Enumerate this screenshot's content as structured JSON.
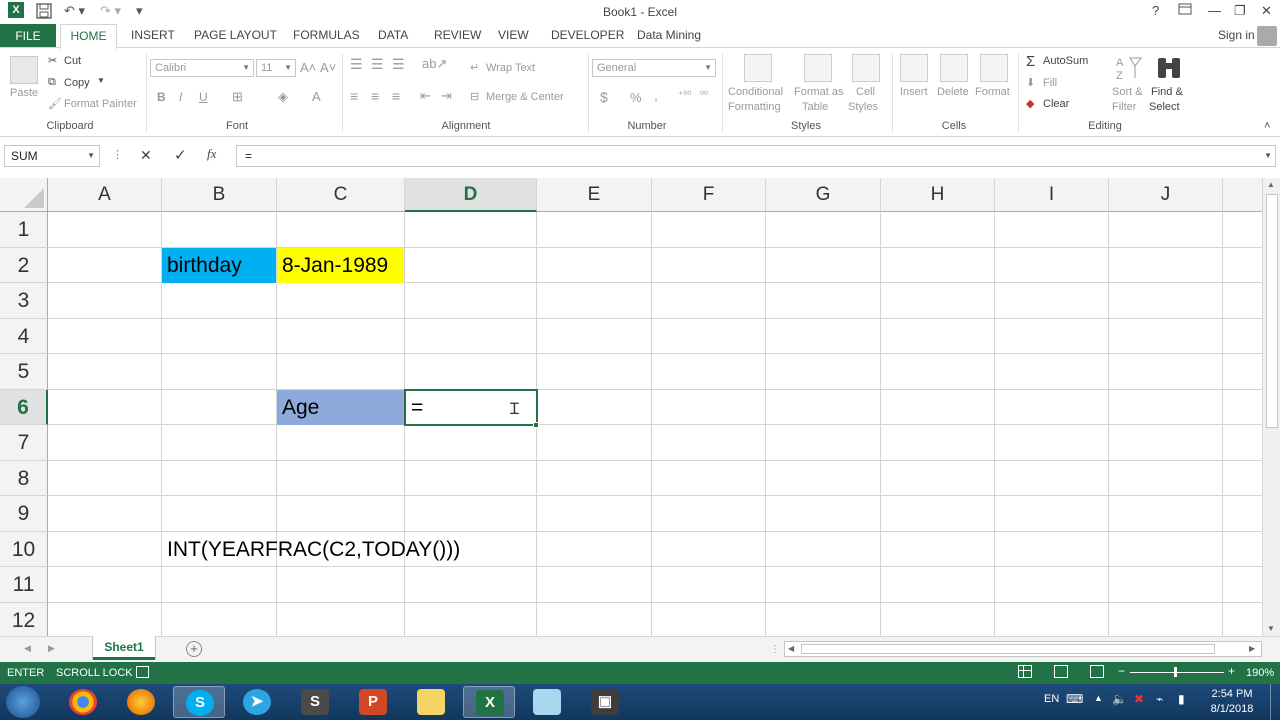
{
  "window": {
    "title": "Book1 - Excel",
    "signin": "Sign in"
  },
  "tabs": {
    "file": "FILE",
    "items": [
      "HOME",
      "INSERT",
      "PAGE LAYOUT",
      "FORMULAS",
      "DATA",
      "REVIEW",
      "VIEW",
      "DEVELOPER",
      "Data Mining"
    ]
  },
  "ribbon": {
    "clipboard": {
      "label": "Clipboard",
      "paste": "Paste",
      "cut": "Cut",
      "copy": "Copy",
      "format_painter": "Format Painter"
    },
    "font": {
      "label": "Font",
      "font_name": "Calibri",
      "font_size": "11",
      "bold": "B",
      "italic": "I",
      "underline": "U"
    },
    "alignment": {
      "label": "Alignment",
      "wrap_text": "Wrap Text",
      "merge_center": "Merge & Center"
    },
    "number": {
      "label": "Number",
      "format": "General",
      "currency": "$",
      "percent": "%",
      "comma": ","
    },
    "styles": {
      "label": "Styles",
      "conditional_1": "Conditional",
      "conditional_2": "Formatting",
      "format_table_1": "Format as",
      "format_table_2": "Table",
      "cell_styles_1": "Cell",
      "cell_styles_2": "Styles"
    },
    "cells": {
      "label": "Cells",
      "insert": "Insert",
      "delete": "Delete",
      "format": "Format"
    },
    "editing": {
      "label": "Editing",
      "autosum": "AutoSum",
      "fill": "Fill",
      "clear": "Clear",
      "sort_1": "Sort &",
      "sort_2": "Filter",
      "find_1": "Find &",
      "find_2": "Select"
    }
  },
  "formula_bar": {
    "name_box": "SUM",
    "cancel": "✕",
    "enter": "✓",
    "fx": "fx",
    "content": "="
  },
  "grid": {
    "columns": [
      "A",
      "B",
      "C",
      "D",
      "E",
      "F",
      "G",
      "H",
      "I",
      "J"
    ],
    "rows": [
      "1",
      "2",
      "3",
      "4",
      "5",
      "6",
      "7",
      "8",
      "9",
      "10",
      "11",
      "12"
    ],
    "selected_column": "D",
    "selected_row": "6",
    "cells": {
      "B2": "birthday",
      "C2": "8-Jan-1989",
      "C6": "Age",
      "D6": "=",
      "B10": "INT(YEARFRAC(C2,TODAY()))"
    },
    "colors": {
      "B2": "#00b0f0",
      "C2": "#ffff00",
      "C6": "#8ea9db",
      "accent": "#217346"
    }
  },
  "sheets": {
    "active": "Sheet1"
  },
  "status": {
    "mode": "ENTER",
    "scroll_lock": "SCROLL LOCK",
    "zoom": "190%"
  },
  "taskbar": {
    "lang": "EN",
    "time": "2:54 PM",
    "date": "8/1/2018"
  }
}
